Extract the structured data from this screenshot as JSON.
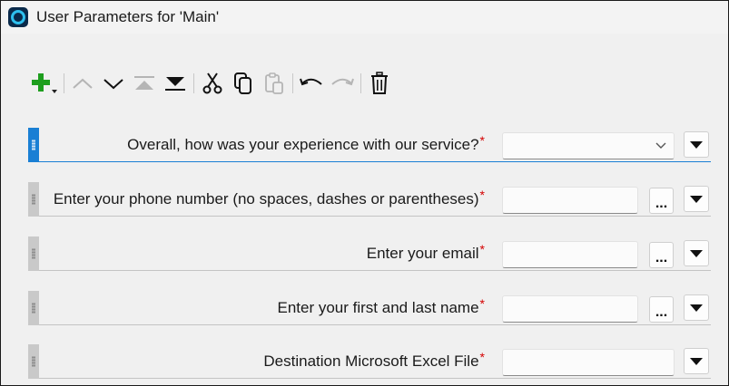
{
  "window": {
    "title": "User Parameters for 'Main'"
  },
  "toolbar": {
    "buttons": [
      {
        "name": "add-icon",
        "enabled": true
      },
      {
        "name": "move-up-icon",
        "enabled": false
      },
      {
        "name": "move-down-icon",
        "enabled": true
      },
      {
        "name": "move-top-icon",
        "enabled": false
      },
      {
        "name": "move-bottom-icon",
        "enabled": true
      },
      {
        "name": "cut-icon",
        "enabled": true
      },
      {
        "name": "copy-icon",
        "enabled": true
      },
      {
        "name": "paste-icon",
        "enabled": false
      },
      {
        "name": "undo-icon",
        "enabled": true
      },
      {
        "name": "redo-icon",
        "enabled": false
      },
      {
        "name": "delete-icon",
        "enabled": true
      }
    ]
  },
  "parameters": [
    {
      "label": "Overall, how was your experience with our service?",
      "required_mark": "*",
      "value": "",
      "control": "select"
    },
    {
      "label": "Enter your phone number (no spaces, dashes or parentheses)",
      "required_mark": "*",
      "value": "",
      "control": "text-browse"
    },
    {
      "label": "Enter your email",
      "required_mark": "*",
      "value": "",
      "control": "text-browse"
    },
    {
      "label": "Enter your first and last name",
      "required_mark": "*",
      "value": "",
      "control": "text-browse"
    },
    {
      "label": "Destination Microsoft Excel File",
      "required_mark": "*",
      "value": "",
      "control": "text"
    }
  ],
  "browse_button_label": "...",
  "colors": {
    "accent": "#1a7fd4",
    "required": "#d40000",
    "add_green": "#1e9e1e"
  }
}
